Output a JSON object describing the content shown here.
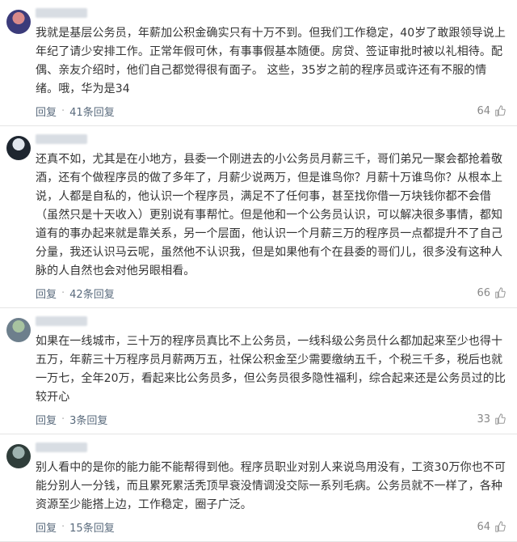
{
  "comments": [
    {
      "avatar_colors": [
        "#3b3b7a",
        "#d98a8a"
      ],
      "text": "我就是基层公务员，年薪加公积金确实只有十万不到。但我们工作稳定，40岁了敢跟领导说上年纪了请少安排工作。正常年假可休，有事事假基本随便。房贷、签证审批时被以礼相待。配偶、亲友介绍时，他们自己都觉得很有面子。 这些，35岁之前的程序员或许还有不服的情绪。哦，华为是34",
      "reply": "回复",
      "replies": "41条回复",
      "likes": "64"
    },
    {
      "avatar_colors": [
        "#1e2630",
        "#e0e6ee"
      ],
      "text": "还真不如，尤其是在小地方，县委一个刚进去的小公务员月薪三千，哥们弟兄一聚会都抢着敬酒，还有个做程序员的做了多年了，月薪少说两万，但是谁鸟你？月薪十万谁鸟你？从根本上说，人都是自私的，他认识一个程序员，满足不了任何事，甚至找你借一万块钱你都不会借（虽然只是十天收入）更别说有事帮忙。但是他和一个公务员认识，可以解决很多事情，都知道有的事办起来就是靠关系，另一个层面，他认识一个月薪三万的程序员一点都提升不了自己分量，我还认识马云呢，虽然他不认识我，但是如果他有个在县委的哥们儿，很多没有这种人脉的人自然也会对他另眼相看。",
      "reply": "回复",
      "replies": "42条回复",
      "likes": "66"
    },
    {
      "avatar_colors": [
        "#6d7f8c",
        "#a7c3a0"
      ],
      "text": "如果在一线城市，三十万的程序员真比不上公务员，一线科级公务员什么都加起来至少也得十五万，年薪三十万程序员月薪两万五，社保公积金至少需要缴纳五千，个税三千多，税后也就一万七，全年20万，看起来比公务员多，但公务员很多隐性福利，综合起来还是公务员过的比较开心",
      "reply": "回复",
      "replies": "3条回复",
      "likes": "33"
    },
    {
      "avatar_colors": [
        "#2f3d3a",
        "#9fb3b0"
      ],
      "text": "别人看中的是你的能力能不能帮得到他。程序员职业对别人来说鸟用没有，工资30万你也不可能分别人一分钱，而且累死累活秃顶早衰没情调没交际一系列毛病。公务员就不一样了，各种资源至少能搭上边，工作稳定，圈子广泛。",
      "reply": "回复",
      "replies": "15条回复",
      "likes": "64"
    }
  ]
}
